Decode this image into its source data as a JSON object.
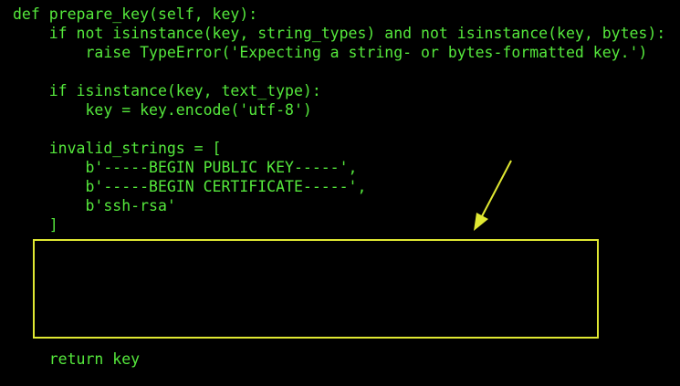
{
  "colors": {
    "background": "#000000",
    "code_text": "#55e83c",
    "annotation": "#e0e832"
  },
  "code": {
    "lines": [
      "def prepare_key(self, key):",
      "    if not isinstance(key, string_types) and not isinstance(key, bytes):",
      "        raise TypeError('Expecting a string- or bytes-formatted key.')",
      "",
      "    if isinstance(key, text_type):",
      "        key = key.encode('utf-8')",
      "",
      "    invalid_strings = [",
      "        b'-----BEGIN PUBLIC KEY-----',",
      "        b'-----BEGIN CERTIFICATE-----',",
      "        b'ssh-rsa'",
      "    ]",
      "    return key"
    ]
  },
  "annotation": {
    "highlight_box_text": "",
    "arrow_icon": "arrow-pointing-down-left-icon"
  }
}
